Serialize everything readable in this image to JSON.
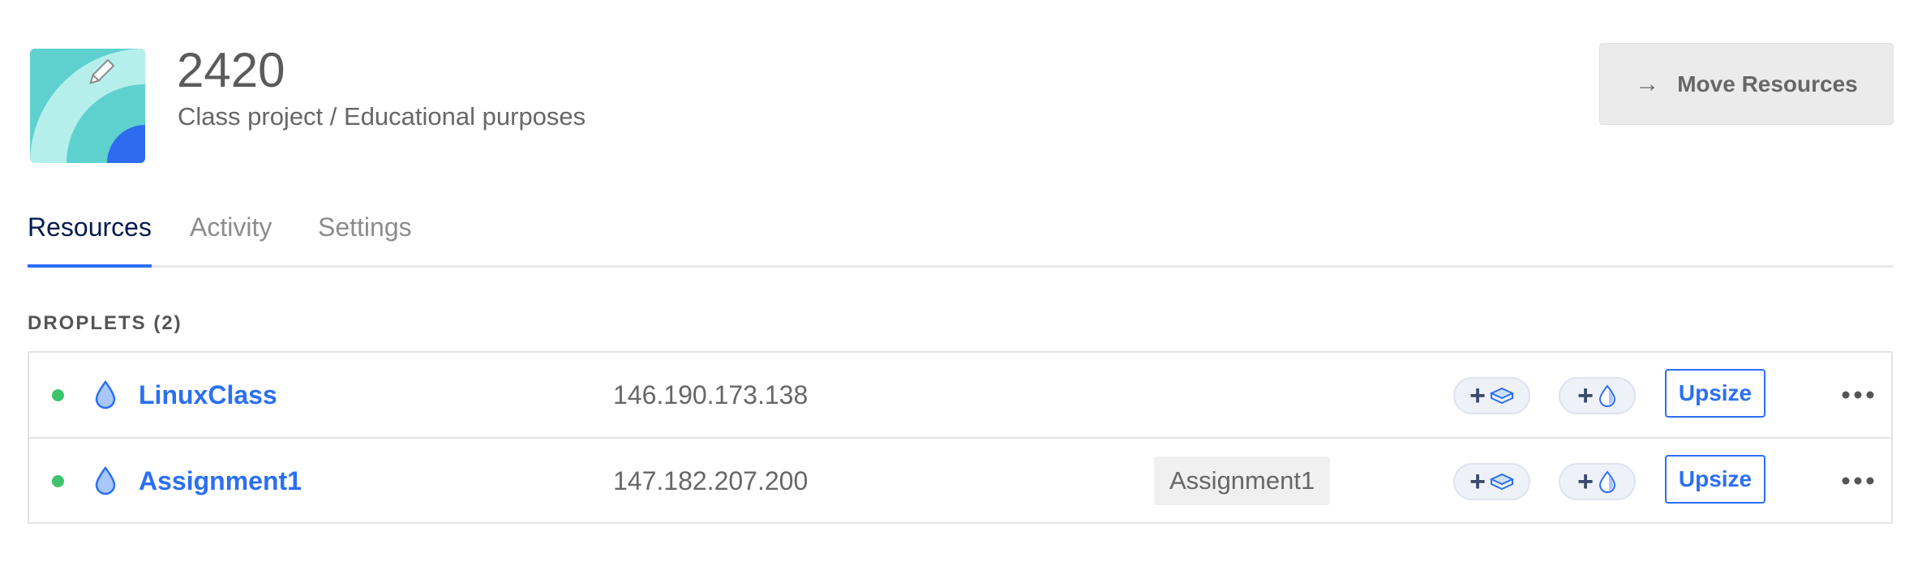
{
  "header": {
    "title": "2420",
    "description": "Class project / Educational purposes",
    "move_button_label": "Move Resources",
    "move_arrow": "→"
  },
  "tabs": [
    {
      "label": "Resources",
      "active": true
    },
    {
      "label": "Activity",
      "active": false
    },
    {
      "label": "Settings",
      "active": false
    }
  ],
  "section": {
    "title": "DROPLETS (2)"
  },
  "droplets": [
    {
      "name": "LinuxClass",
      "ip": "146.190.173.138",
      "tag": "",
      "status": "active",
      "upsize_label": "Upsize"
    },
    {
      "name": "Assignment1",
      "ip": "147.182.207.200",
      "tag": "Assignment1",
      "status": "active",
      "upsize_label": "Upsize"
    }
  ],
  "icons": {
    "project": "project-avatar-icon",
    "edit": "pencil-icon",
    "droplet": "droplet-icon",
    "volume": "volume-icon",
    "snapshot": "snapshot-icon",
    "more": "more-dots-icon"
  },
  "colors": {
    "accent": "#2b6ff3",
    "status_active": "#3ec46d",
    "tab_active": "#031b4e"
  }
}
